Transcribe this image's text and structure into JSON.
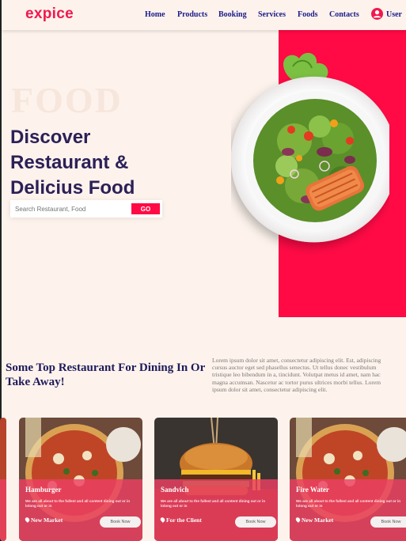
{
  "brand": {
    "logo": "expice",
    "accent": "#ff0a45",
    "navy": "#2c2058"
  },
  "nav": {
    "links": [
      "Home",
      "Products",
      "Booking",
      "Services",
      "Foods",
      "Contacts"
    ],
    "user_label": "User",
    "user_icon": "user-icon"
  },
  "hero": {
    "bg_word": "FOOD",
    "title_line1": "Discover",
    "title_line2": "Restaurant &",
    "title_line3": "Delicius Food",
    "search_placeholder": "Search Restaurant, Food",
    "go_label": "GO"
  },
  "section": {
    "title": "Some Top Restaurant For Dining In Or Take Away!",
    "text": "Lorem ipsum dolor sit amet, consectetur adipiscing elit. Est, adipiscing cursus auctor eget sed phasellus senectus. Ut tellus donec vestibulum tristique leo bibendum in a, tincidunt. Volutpat metus id amet, nam hac magna accumsan. Nascetur ac tortor purus ultrices morbi tellus. Lorem ipsum dolor sit amet, consectetur adipiscing elit."
  },
  "cards": [
    {
      "name": "Hamburger",
      "desc": "We are all about to the fullest and all content dining out or in lolong out or in",
      "location": "New Market",
      "button": "Book Now"
    },
    {
      "name": "Sandvich",
      "desc": "We are all about to the fullest and all content dining out or in lolong out or in",
      "location": "For the Client",
      "button": "Book Now"
    },
    {
      "name": "Fire Water",
      "desc": "We are all about to the fullest and all content dining out or in lolong out or in",
      "location": "New Market",
      "button": "Book Now"
    }
  ]
}
